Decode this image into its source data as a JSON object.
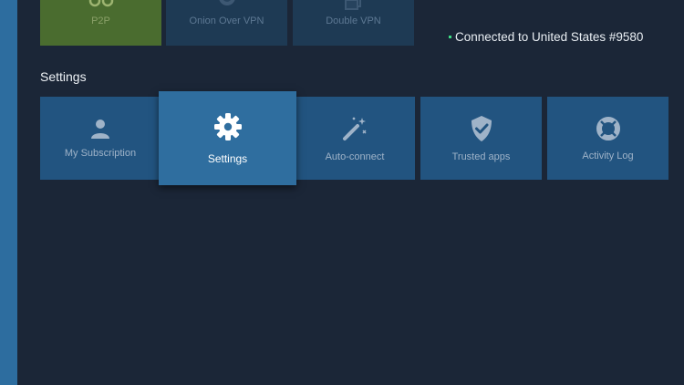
{
  "servers": {
    "tiles": [
      {
        "label": "P2P",
        "icon": "p2p-icon"
      },
      {
        "label": "Onion Over VPN",
        "icon": "globe-icon"
      },
      {
        "label": "Double VPN",
        "icon": "double-vpn-icon"
      }
    ]
  },
  "status": {
    "text": "Connected to United States #9580",
    "indicator_color": "#3ddc84"
  },
  "settings": {
    "title": "Settings",
    "tiles": [
      {
        "label": "My Subscription",
        "icon": "user-icon"
      },
      {
        "label": "Settings",
        "icon": "gear-icon",
        "focused": true
      },
      {
        "label": "Auto-connect",
        "icon": "magic-wand-icon"
      },
      {
        "label": "Trusted apps",
        "icon": "shield-check-icon"
      },
      {
        "label": "Activity Log",
        "icon": "lifebuoy-icon"
      }
    ]
  },
  "colors": {
    "background": "#1b2637",
    "tile": "#225480",
    "tile_focused": "#2f6e9f",
    "p2p_tile": "#4a6c2f",
    "side_rail": "#2d6d9f"
  }
}
